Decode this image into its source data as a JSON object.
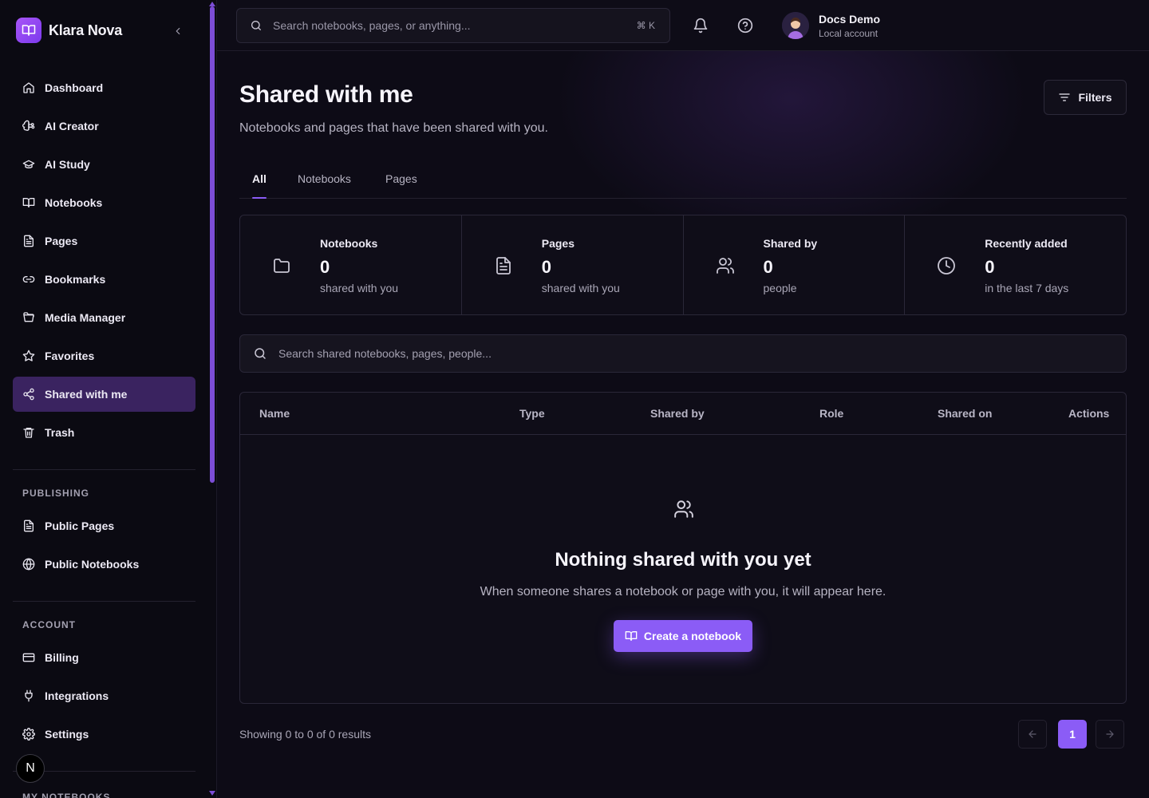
{
  "brand": {
    "name": "Klara Nova"
  },
  "sidebar": {
    "items": [
      {
        "label": "Dashboard",
        "icon": "home-icon"
      },
      {
        "label": "AI Creator",
        "icon": "brain-icon"
      },
      {
        "label": "AI Study",
        "icon": "graduation-cap-icon"
      },
      {
        "label": "Notebooks",
        "icon": "book-open-icon"
      },
      {
        "label": "Pages",
        "icon": "file-text-icon"
      },
      {
        "label": "Bookmarks",
        "icon": "link-icon"
      },
      {
        "label": "Media Manager",
        "icon": "folder-open-icon"
      },
      {
        "label": "Favorites",
        "icon": "star-icon"
      },
      {
        "label": "Shared with me",
        "icon": "share-icon",
        "active": true
      },
      {
        "label": "Trash",
        "icon": "trash-icon"
      }
    ],
    "publishing_label": "PUBLISHING",
    "publishing": [
      {
        "label": "Public Pages",
        "icon": "file-text-icon"
      },
      {
        "label": "Public Notebooks",
        "icon": "globe-icon"
      }
    ],
    "account_label": "ACCOUNT",
    "account": [
      {
        "label": "Billing",
        "icon": "credit-card-icon"
      },
      {
        "label": "Integrations",
        "icon": "plug-icon"
      },
      {
        "label": "Settings",
        "icon": "gear-icon"
      }
    ],
    "my_notebooks_label": "MY NOTEBOOKS",
    "badge_letter": "N"
  },
  "topbar": {
    "search_placeholder": "Search notebooks, pages, or anything...",
    "shortcut": "⌘ K",
    "user_name": "Docs Demo",
    "user_sub": "Local account"
  },
  "page": {
    "title": "Shared with me",
    "subtitle": "Notebooks and pages that have been shared with you.",
    "filters_label": "Filters",
    "tabs": [
      {
        "label": "All",
        "active": true
      },
      {
        "label": "Notebooks"
      },
      {
        "label": "Pages"
      }
    ]
  },
  "stats": [
    {
      "label": "Notebooks",
      "value": "0",
      "desc": "shared with you",
      "icon": "folder-icon"
    },
    {
      "label": "Pages",
      "value": "0",
      "desc": "shared with you",
      "icon": "file-text-icon"
    },
    {
      "label": "Shared by",
      "value": "0",
      "desc": "people",
      "icon": "users-icon"
    },
    {
      "label": "Recently added",
      "value": "0",
      "desc": "in the last 7 days",
      "icon": "clock-icon"
    }
  ],
  "shared_search": {
    "placeholder": "Search shared notebooks, pages, people..."
  },
  "table": {
    "columns": [
      "Name",
      "Type",
      "Shared by",
      "Role",
      "Shared on",
      "Actions"
    ],
    "empty_title": "Nothing shared with you yet",
    "empty_desc": "When someone shares a notebook or page with you, it will appear here.",
    "create_label": "Create a notebook"
  },
  "footer": {
    "results": "Showing 0 to 0 of 0 results",
    "current_page": "1"
  },
  "colors": {
    "accent": "#8b5cf6",
    "active_nav": "#3a2360",
    "background": "#0d0b16"
  }
}
